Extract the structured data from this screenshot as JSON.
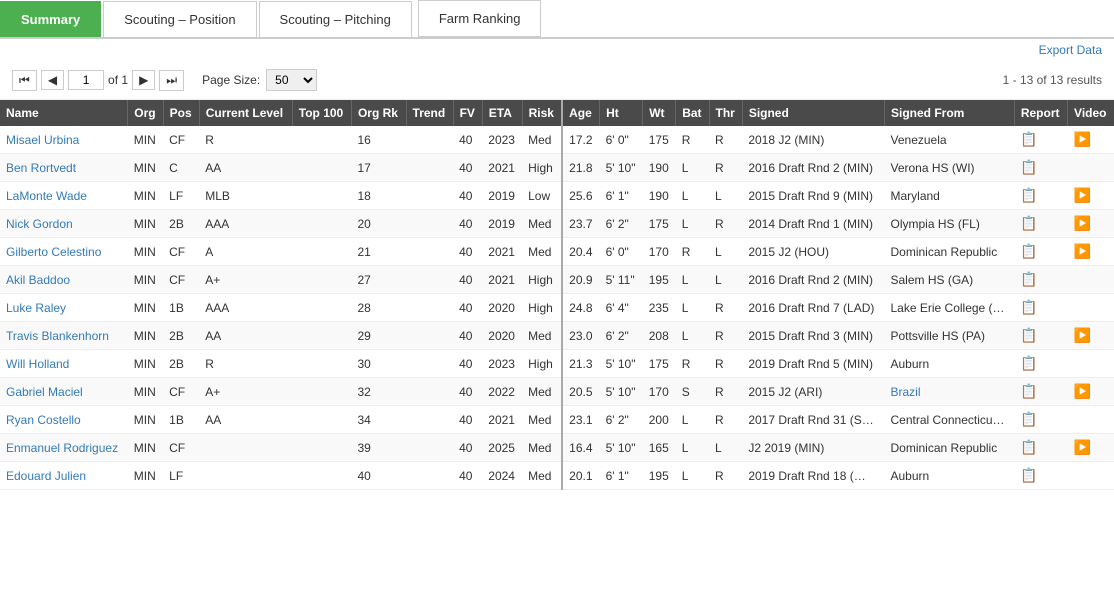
{
  "tabs": [
    {
      "id": "summary",
      "label": "Summary",
      "active": true
    },
    {
      "id": "scouting-position",
      "label": "Scouting – Position",
      "active": false
    },
    {
      "id": "scouting-pitching",
      "label": "Scouting – Pitching",
      "active": false
    },
    {
      "id": "farm-ranking",
      "label": "Farm Ranking",
      "active": false
    }
  ],
  "toolbar": {
    "export_label": "Export Data",
    "page_current": "1",
    "page_of": "of 1",
    "results_info": "1 - 13 of 13 results",
    "page_size_label": "Page Size:",
    "page_size_value": "50"
  },
  "table": {
    "headers": [
      "Name",
      "Org",
      "Pos",
      "Current Level",
      "Top 100",
      "Org Rk",
      "Trend",
      "FV",
      "ETA",
      "Risk",
      "Age",
      "Ht",
      "Wt",
      "Bat",
      "Thr",
      "Signed",
      "Signed From",
      "Report",
      "Video"
    ],
    "rows": [
      {
        "name": "Misael Urbina",
        "org": "MIN",
        "pos": "CF",
        "current_level": "R",
        "top100": "",
        "org_rk": "16",
        "trend": "",
        "fv": "40",
        "eta": "2023",
        "risk": "Med",
        "age": "17.2",
        "ht": "6' 0\"",
        "wt": "175",
        "bat": "R",
        "thr": "R",
        "signed": "2018 J2 (MIN)",
        "signed_from": "Venezuela",
        "signed_from_link": false,
        "has_report": true,
        "has_video": true
      },
      {
        "name": "Ben Rortvedt",
        "org": "MIN",
        "pos": "C",
        "current_level": "AA",
        "top100": "",
        "org_rk": "17",
        "trend": "",
        "fv": "40",
        "eta": "2021",
        "risk": "High",
        "age": "21.8",
        "ht": "5' 10\"",
        "wt": "190",
        "bat": "L",
        "thr": "R",
        "signed": "2016 Draft Rnd 2 (MIN)",
        "signed_from": "Verona HS (WI)",
        "signed_from_link": false,
        "has_report": true,
        "has_video": false
      },
      {
        "name": "LaMonte Wade",
        "org": "MIN",
        "pos": "LF",
        "current_level": "MLB",
        "top100": "",
        "org_rk": "18",
        "trend": "",
        "fv": "40",
        "eta": "2019",
        "risk": "Low",
        "age": "25.6",
        "ht": "6' 1\"",
        "wt": "190",
        "bat": "L",
        "thr": "L",
        "signed": "2015 Draft Rnd 9 (MIN)",
        "signed_from": "Maryland",
        "signed_from_link": false,
        "has_report": true,
        "has_video": true
      },
      {
        "name": "Nick Gordon",
        "org": "MIN",
        "pos": "2B",
        "current_level": "AAA",
        "top100": "",
        "org_rk": "20",
        "trend": "",
        "fv": "40",
        "eta": "2019",
        "risk": "Med",
        "age": "23.7",
        "ht": "6' 2\"",
        "wt": "175",
        "bat": "L",
        "thr": "R",
        "signed": "2014 Draft Rnd 1 (MIN)",
        "signed_from": "Olympia HS (FL)",
        "signed_from_link": false,
        "has_report": true,
        "has_video": true
      },
      {
        "name": "Gilberto Celestino",
        "org": "MIN",
        "pos": "CF",
        "current_level": "A",
        "top100": "",
        "org_rk": "21",
        "trend": "",
        "fv": "40",
        "eta": "2021",
        "risk": "Med",
        "age": "20.4",
        "ht": "6' 0\"",
        "wt": "170",
        "bat": "R",
        "thr": "L",
        "signed": "2015 J2 (HOU)",
        "signed_from": "Dominican Republic",
        "signed_from_link": false,
        "has_report": true,
        "has_video": true
      },
      {
        "name": "Akil Baddoo",
        "org": "MIN",
        "pos": "CF",
        "current_level": "A+",
        "top100": "",
        "org_rk": "27",
        "trend": "",
        "fv": "40",
        "eta": "2021",
        "risk": "High",
        "age": "20.9",
        "ht": "5' 11\"",
        "wt": "195",
        "bat": "L",
        "thr": "L",
        "signed": "2016 Draft Rnd 2 (MIN)",
        "signed_from": "Salem HS (GA)",
        "signed_from_link": false,
        "has_report": true,
        "has_video": false
      },
      {
        "name": "Luke Raley",
        "org": "MIN",
        "pos": "1B",
        "current_level": "AAA",
        "top100": "",
        "org_rk": "28",
        "trend": "",
        "fv": "40",
        "eta": "2020",
        "risk": "High",
        "age": "24.8",
        "ht": "6' 4\"",
        "wt": "235",
        "bat": "L",
        "thr": "R",
        "signed": "2016 Draft Rnd 7 (LAD)",
        "signed_from": "Lake Erie College (…",
        "signed_from_link": false,
        "has_report": true,
        "has_video": false
      },
      {
        "name": "Travis Blankenhorn",
        "org": "MIN",
        "pos": "2B",
        "current_level": "AA",
        "top100": "",
        "org_rk": "29",
        "trend": "",
        "fv": "40",
        "eta": "2020",
        "risk": "Med",
        "age": "23.0",
        "ht": "6' 2\"",
        "wt": "208",
        "bat": "L",
        "thr": "R",
        "signed": "2015 Draft Rnd 3 (MIN)",
        "signed_from": "Pottsville HS (PA)",
        "signed_from_link": false,
        "has_report": true,
        "has_video": true
      },
      {
        "name": "Will Holland",
        "org": "MIN",
        "pos": "2B",
        "current_level": "R",
        "top100": "",
        "org_rk": "30",
        "trend": "",
        "fv": "40",
        "eta": "2023",
        "risk": "High",
        "age": "21.3",
        "ht": "5' 10\"",
        "wt": "175",
        "bat": "R",
        "thr": "R",
        "signed": "2019 Draft Rnd 5 (MIN)",
        "signed_from": "Auburn",
        "signed_from_link": false,
        "has_report": true,
        "has_video": false
      },
      {
        "name": "Gabriel Maciel",
        "org": "MIN",
        "pos": "CF",
        "current_level": "A+",
        "top100": "",
        "org_rk": "32",
        "trend": "",
        "fv": "40",
        "eta": "2022",
        "risk": "Med",
        "age": "20.5",
        "ht": "5' 10\"",
        "wt": "170",
        "bat": "S",
        "thr": "R",
        "signed": "2015 J2 (ARI)",
        "signed_from": "Brazil",
        "signed_from_link": true,
        "has_report": true,
        "has_video": true
      },
      {
        "name": "Ryan Costello",
        "org": "MIN",
        "pos": "1B",
        "current_level": "AA",
        "top100": "",
        "org_rk": "34",
        "trend": "",
        "fv": "40",
        "eta": "2021",
        "risk": "Med",
        "age": "23.1",
        "ht": "6' 2\"",
        "wt": "200",
        "bat": "L",
        "thr": "R",
        "signed": "2017 Draft Rnd 31 (S…",
        "signed_from": "Central Connecticu…",
        "signed_from_link": false,
        "has_report": true,
        "has_video": false
      },
      {
        "name": "Enmanuel Rodriguez",
        "org": "MIN",
        "pos": "CF",
        "current_level": "",
        "top100": "",
        "org_rk": "39",
        "trend": "",
        "fv": "40",
        "eta": "2025",
        "risk": "Med",
        "age": "16.4",
        "ht": "5' 10\"",
        "wt": "165",
        "bat": "L",
        "thr": "L",
        "signed": "J2 2019 (MIN)",
        "signed_from": "Dominican Republic",
        "signed_from_link": false,
        "has_report": true,
        "has_video": true
      },
      {
        "name": "Edouard Julien",
        "org": "MIN",
        "pos": "LF",
        "current_level": "",
        "top100": "",
        "org_rk": "40",
        "trend": "",
        "fv": "40",
        "eta": "2024",
        "risk": "Med",
        "age": "20.1",
        "ht": "6' 1\"",
        "wt": "195",
        "bat": "L",
        "thr": "R",
        "signed": "2019 Draft Rnd 18 (…",
        "signed_from": "Auburn",
        "signed_from_link": false,
        "has_report": true,
        "has_video": false
      }
    ]
  }
}
